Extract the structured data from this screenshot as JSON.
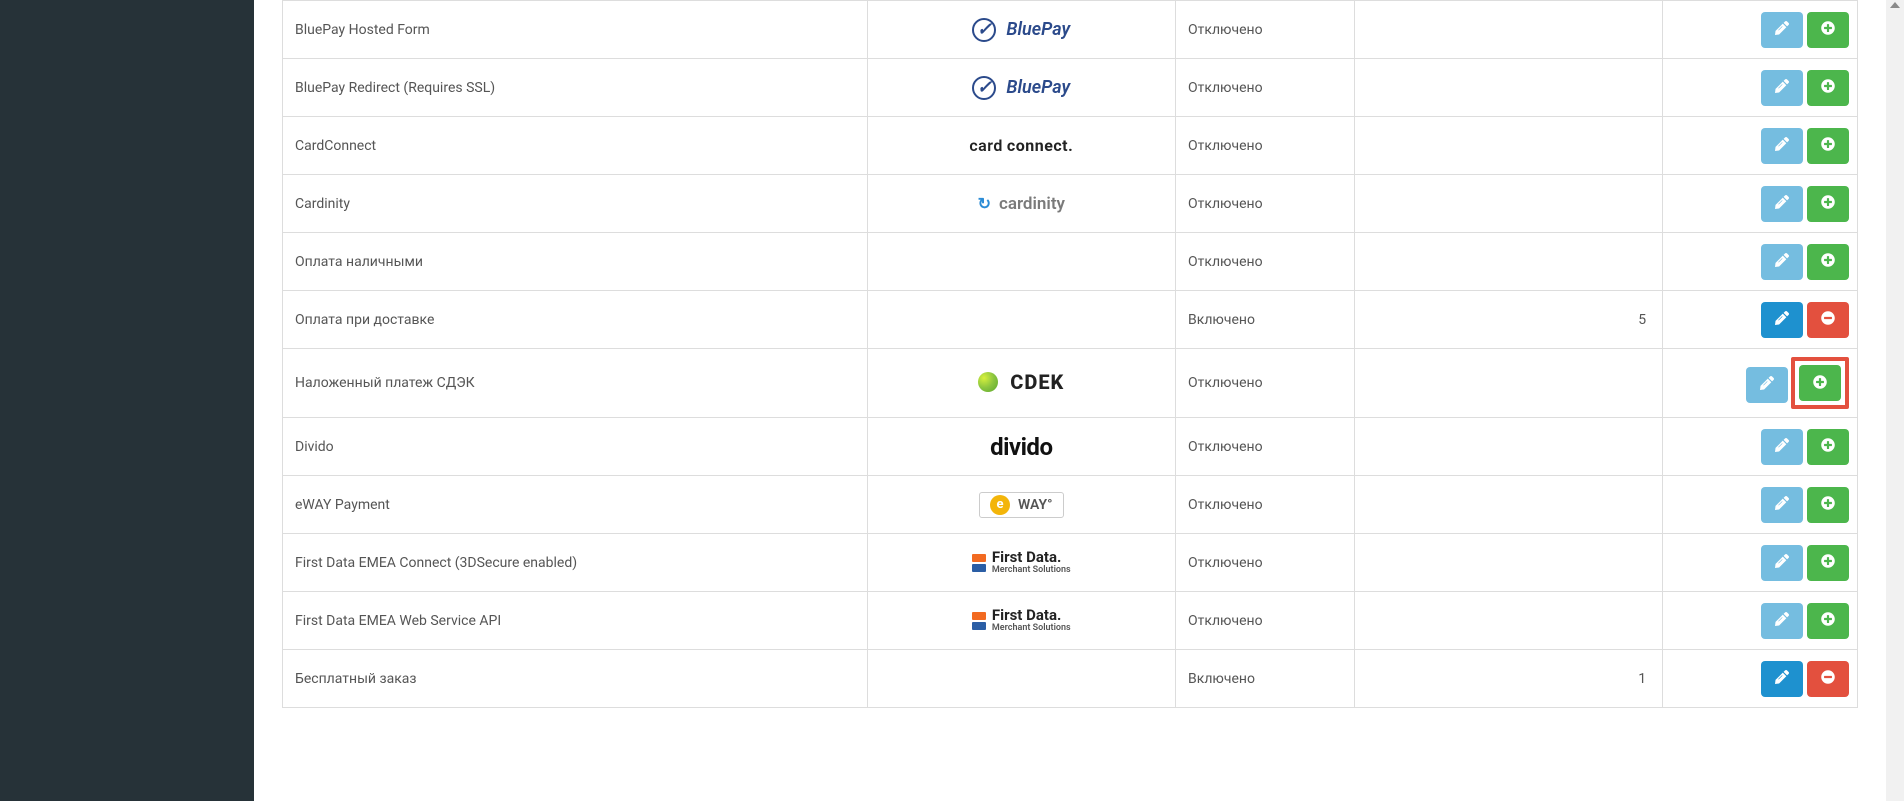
{
  "status": {
    "enabled": "Включено",
    "disabled": "Отключено"
  },
  "rows": [
    {
      "name": "BluePay Hosted Form",
      "logo": "bluepay",
      "status_key": "disabled",
      "sort": "",
      "installed": false,
      "highlighted": false
    },
    {
      "name": "BluePay Redirect (Requires SSL)",
      "logo": "bluepay",
      "status_key": "disabled",
      "sort": "",
      "installed": false,
      "highlighted": false
    },
    {
      "name": "CardConnect",
      "logo": "cardconnect",
      "status_key": "disabled",
      "sort": "",
      "installed": false,
      "highlighted": false
    },
    {
      "name": "Cardinity",
      "logo": "cardinity",
      "status_key": "disabled",
      "sort": "",
      "installed": false,
      "highlighted": false
    },
    {
      "name": "Оплата наличными",
      "logo": "",
      "status_key": "disabled",
      "sort": "",
      "installed": false,
      "highlighted": false
    },
    {
      "name": "Оплата при доставке",
      "logo": "",
      "status_key": "enabled",
      "sort": "5",
      "installed": true,
      "highlighted": false
    },
    {
      "name": "Наложенный платеж СДЭК",
      "logo": "cdek",
      "status_key": "disabled",
      "sort": "",
      "installed": false,
      "highlighted": true
    },
    {
      "name": "Divido",
      "logo": "divido",
      "status_key": "disabled",
      "sort": "",
      "installed": false,
      "highlighted": false
    },
    {
      "name": "eWAY Payment",
      "logo": "eway",
      "status_key": "disabled",
      "sort": "",
      "installed": false,
      "highlighted": false
    },
    {
      "name": "First Data EMEA Connect (3DSecure enabled)",
      "logo": "firstdata",
      "status_key": "disabled",
      "sort": "",
      "installed": false,
      "highlighted": false
    },
    {
      "name": "First Data EMEA Web Service API",
      "logo": "firstdata",
      "status_key": "disabled",
      "sort": "",
      "installed": false,
      "highlighted": false
    },
    {
      "name": "Бесплатный заказ",
      "logo": "",
      "status_key": "enabled",
      "sort": "1",
      "installed": true,
      "highlighted": false
    }
  ],
  "logos": {
    "bluepay": {
      "text": "BluePay"
    },
    "cardconnect": {
      "text1": "card",
      "text2": "connect."
    },
    "cardinity": {
      "text": "cardinity"
    },
    "cdek": {
      "text": "CDEK"
    },
    "divido": {
      "text": "divido"
    },
    "eway": {
      "text": "WAY°"
    },
    "firstdata": {
      "t1": "First Data.",
      "t2": "Merchant Solutions"
    }
  }
}
